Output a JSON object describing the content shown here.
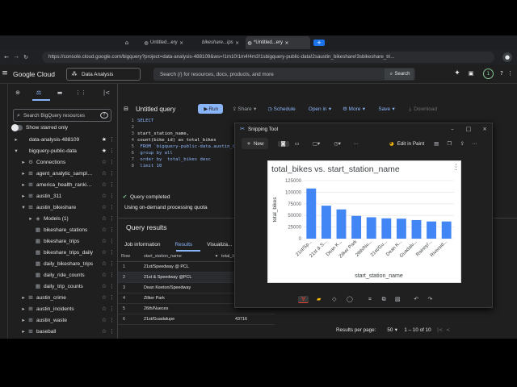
{
  "browser": {
    "tabs": [
      "Untitled...ery",
      "bikeshare...ips",
      "*Untitled...ery"
    ],
    "url": "https://console.cloud.google.com/bigquery?project=data-analysis-488109&ws=!1m10!1m4!4m3!1sbigquery-public-data!2saustin_bikeshare!3sbikeshare_tri..."
  },
  "gc": {
    "brand": "Google Cloud",
    "project": "Data Analysis",
    "search_placeholder": "Search (/) for resources, docs, products, and more",
    "search_button": "Search",
    "avatar": "1"
  },
  "explorer": {
    "search_placeholder": "Search BigQuery resources",
    "show_starred": "Show starred only",
    "items": [
      {
        "label": "data-analysis-488109",
        "depth": 0,
        "arrow": "▸",
        "icon": "",
        "starred": true
      },
      {
        "label": "bigquery-public-data",
        "depth": 0,
        "arrow": "▾",
        "icon": "",
        "starred": true
      },
      {
        "label": "Connections",
        "depth": 1,
        "arrow": "▸",
        "icon": "⚙",
        "starred": false
      },
      {
        "label": "agent_analytic_sample_...",
        "depth": 1,
        "arrow": "▸",
        "icon": "⊞",
        "starred": false
      },
      {
        "label": "america_health_rankings",
        "depth": 1,
        "arrow": "▸",
        "icon": "⊞",
        "starred": false
      },
      {
        "label": "austin_311",
        "depth": 1,
        "arrow": "▸",
        "icon": "⊞",
        "starred": false
      },
      {
        "label": "austin_bikeshare",
        "depth": 1,
        "arrow": "▾",
        "icon": "⊞",
        "starred": false
      },
      {
        "label": "Models (1)",
        "depth": 2,
        "arrow": "▸",
        "icon": "◈",
        "starred": false
      },
      {
        "label": "bikeshare_stations",
        "depth": 2,
        "arrow": "",
        "icon": "▦",
        "starred": false
      },
      {
        "label": "bikeshare_trips",
        "depth": 2,
        "arrow": "",
        "icon": "▦",
        "starred": false
      },
      {
        "label": "bikeshare_trips_daily",
        "depth": 2,
        "arrow": "",
        "icon": "▦",
        "starred": false
      },
      {
        "label": "daily_bikeshare_trips",
        "depth": 2,
        "arrow": "",
        "icon": "▦",
        "starred": false
      },
      {
        "label": "daily_ride_counts",
        "depth": 2,
        "arrow": "",
        "icon": "▦",
        "starred": false
      },
      {
        "label": "daily_trip_counts",
        "depth": 2,
        "arrow": "",
        "icon": "▦",
        "starred": false
      },
      {
        "label": "austin_crime",
        "depth": 1,
        "arrow": "▸",
        "icon": "⊞",
        "starred": false
      },
      {
        "label": "austin_incidents",
        "depth": 1,
        "arrow": "▸",
        "icon": "⊞",
        "starred": false
      },
      {
        "label": "austin_waste",
        "depth": 1,
        "arrow": "▸",
        "icon": "⊞",
        "starred": false
      },
      {
        "label": "baseball",
        "depth": 1,
        "arrow": "▸",
        "icon": "⊞",
        "starred": false
      }
    ]
  },
  "editor": {
    "title": "Untitled query",
    "run": "Run",
    "share": "Share",
    "schedule": "Schedule",
    "open_in": "Open in",
    "more": "More",
    "save": "Save",
    "download": "Download",
    "line_numbers": [
      "1",
      "2",
      "3",
      "4",
      "5",
      "6",
      "7",
      "8"
    ],
    "code": [
      "SELECT",
      "",
      "start_station_name,",
      "count(bike_id) as total_bikes",
      " FROM `bigquery-public-data.austin_b",
      " group by all",
      " order by  total_bikes desc",
      " limit 10"
    ],
    "status": "Query completed",
    "quota": "Using on-demand processing quota"
  },
  "results": {
    "heading": "Query results",
    "tabs": [
      "Job information",
      "Results",
      "Visualiza..."
    ],
    "columns": [
      "Row",
      "start_station_name",
      "total_bi..."
    ],
    "rows": [
      {
        "n": "1",
        "name": "21st/Speedway @ PCL",
        "total": ""
      },
      {
        "n": "2",
        "name": "21st & Speedway @PCL",
        "total": ""
      },
      {
        "n": "3",
        "name": "Dean Keeton/Speedway",
        "total": ""
      },
      {
        "n": "4",
        "name": "Zilker Park",
        "total": ""
      },
      {
        "n": "5",
        "name": "26th/Nueces",
        "total": ""
      },
      {
        "n": "6",
        "name": "21st/Guadalupe",
        "total": "43716"
      }
    ],
    "per_page_label": "Results per page:",
    "per_page": "50",
    "range": "1 – 10 of 10"
  },
  "snipping": {
    "title": "Snipping Tool",
    "new": "New",
    "edit_in_paint": "Edit in Paint"
  },
  "chart_data": {
    "type": "bar",
    "title": "total_bikes vs. start_station_name",
    "xlabel": "start_station_name",
    "ylabel": "total_bikes",
    "categories": [
      "21st/Sp...",
      "21st & S...",
      "Dean K...",
      "Zilker Park",
      "26th/Nu...",
      "21st/Gu...",
      "Dean K...",
      "Guadalu...",
      "Rainey/...",
      "Riversid..."
    ],
    "values": [
      108000,
      71000,
      63000,
      49000,
      46000,
      43716,
      43000,
      40000,
      37000,
      37000
    ],
    "ylim": [
      0,
      125000
    ],
    "yticks": [
      "0",
      "25000",
      "50000",
      "75000",
      "100000",
      "125000"
    ],
    "color": "#4285f4"
  }
}
